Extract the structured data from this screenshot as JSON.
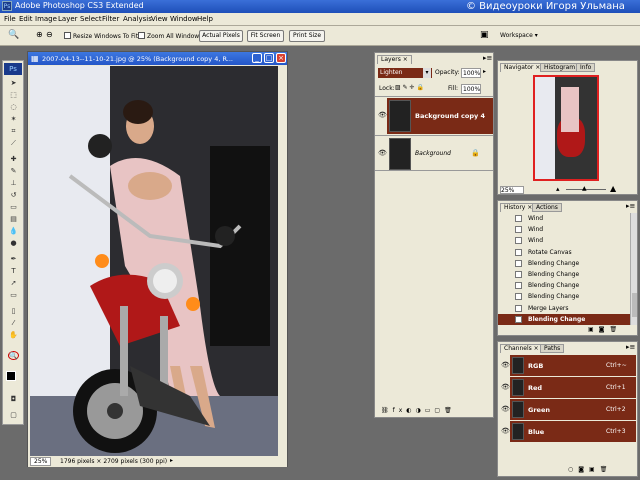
{
  "app": {
    "title": "Adobe Photoshop CS3 Extended",
    "icon": "Ps",
    "watermark": "© Видеоуроки Игоря Ульмана"
  },
  "menu": [
    "File",
    "Edit",
    "Image",
    "Layer",
    "Select",
    "Filter",
    "Analysis",
    "View",
    "Window",
    "Help"
  ],
  "options": {
    "resize_label": "Resize Windows To Fit",
    "zoom_all_label": "Zoom All Windows",
    "actual_pixels": "Actual Pixels",
    "fit_screen": "Fit Screen",
    "print_size": "Print Size",
    "workspace": "Workspace"
  },
  "document": {
    "title": "2007-04-13--11-10-21.jpg @ 25% (Background copy 4, R...",
    "zoom": "25%",
    "info": "1796 pixels × 2709 pixels (300 ppi)"
  },
  "layers": {
    "tab": "Layers",
    "blend_mode": "Lighten",
    "opacity_label": "Opacity:",
    "opacity": "100%",
    "lock_label": "Lock:",
    "fill_label": "Fill:",
    "fill": "100%",
    "items": [
      {
        "name": "Background copy 4",
        "selected": true
      },
      {
        "name": "Background",
        "selected": false
      }
    ]
  },
  "navigator": {
    "tabs": [
      "Navigator",
      "Histogram",
      "Info"
    ],
    "zoom": "25%"
  },
  "history": {
    "tabs": [
      "History",
      "Actions"
    ],
    "items": [
      "Wind",
      "Wind",
      "Wind",
      "Rotate Canvas",
      "Blending Change",
      "Blending Change",
      "Blending Change",
      "Blending Change",
      "Merge Layers",
      "Blending Change"
    ],
    "selected_index": 9
  },
  "channels": {
    "tabs": [
      "Channels",
      "Paths"
    ],
    "items": [
      {
        "name": "RGB",
        "shortcut": "Ctrl+~"
      },
      {
        "name": "Red",
        "shortcut": "Ctrl+1"
      },
      {
        "name": "Green",
        "shortcut": "Ctrl+2"
      },
      {
        "name": "Blue",
        "shortcut": "Ctrl+3"
      }
    ]
  },
  "colors": {
    "accent": "#7a2a16",
    "titlebar": "#2456c8"
  }
}
